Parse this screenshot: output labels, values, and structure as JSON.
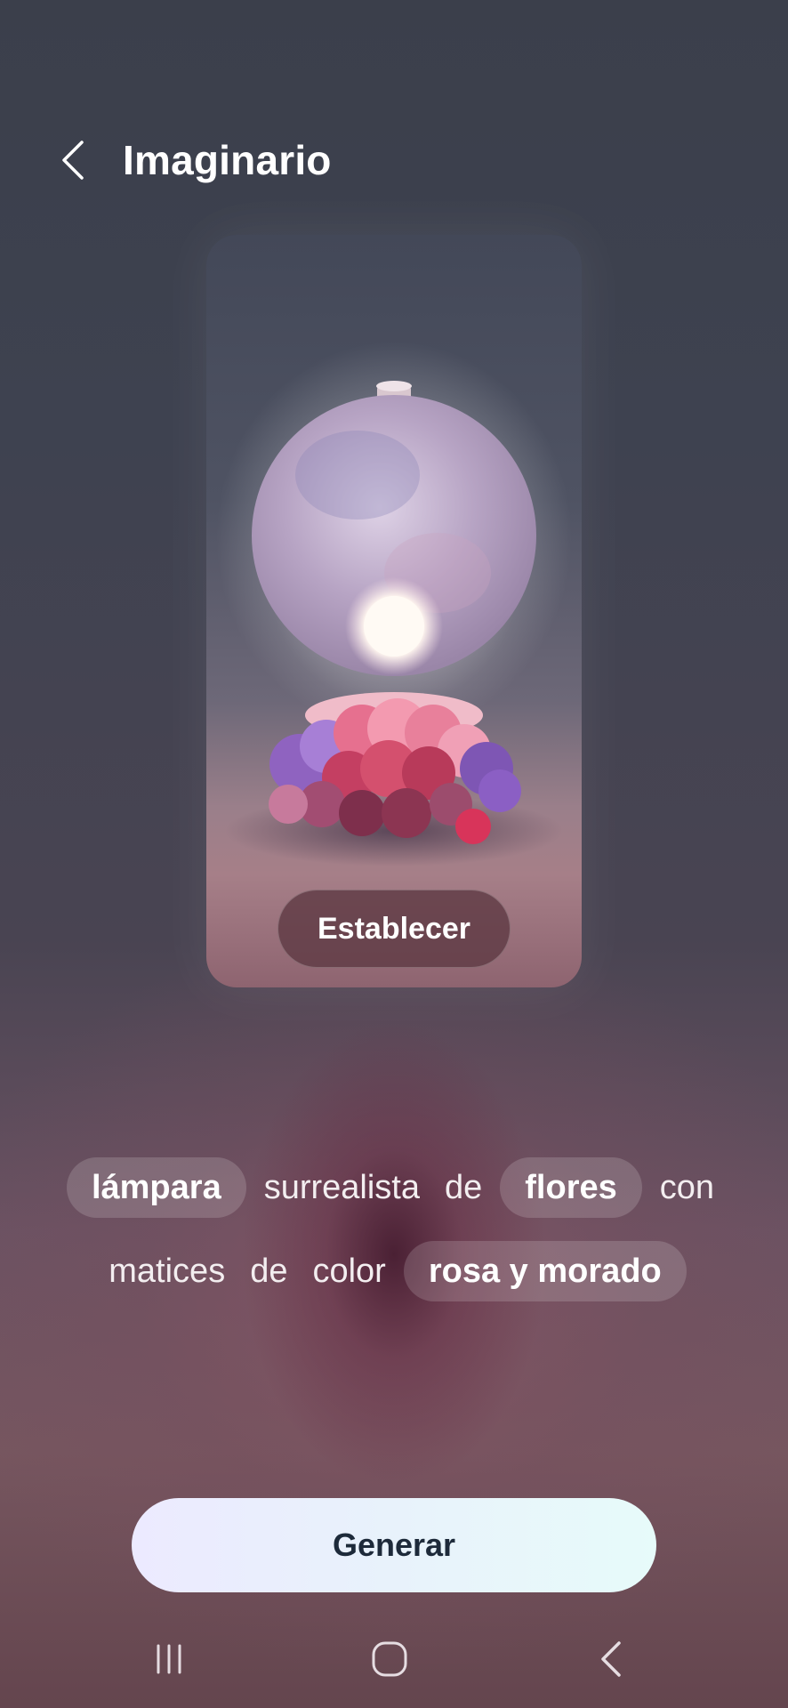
{
  "header": {
    "title": "Imaginario",
    "back_icon": "chevron-left-icon"
  },
  "preview": {
    "set_button_label": "Establecer",
    "image_description_icon": "lamp-flowers-artwork"
  },
  "prompt": {
    "line1": [
      {
        "text": "lámpara",
        "chip": true
      },
      {
        "text": "surrealista",
        "chip": false
      },
      {
        "text": "de",
        "chip": false
      },
      {
        "text": "flores",
        "chip": true
      },
      {
        "text": "con",
        "chip": false
      }
    ],
    "line2": [
      {
        "text": "matices",
        "chip": false
      },
      {
        "text": "de",
        "chip": false
      },
      {
        "text": "color",
        "chip": false
      },
      {
        "text": "rosa y morado",
        "chip": true
      }
    ]
  },
  "generate_button_label": "Generar",
  "navbar": {
    "recents_icon": "recents-icon",
    "home_icon": "home-icon",
    "back_icon": "back-icon"
  },
  "colors": {
    "background_top": "#3b3f4b",
    "background_bottom": "#76565f",
    "generate_button_text": "#1d2a3a",
    "chip_background": "rgba(255,255,255,0.16)"
  }
}
